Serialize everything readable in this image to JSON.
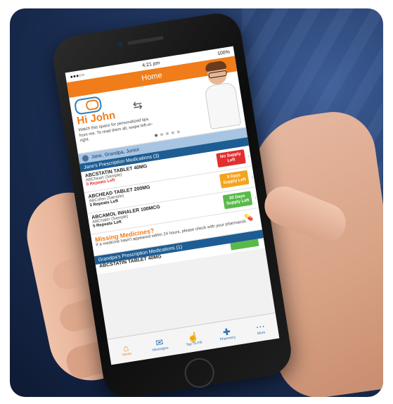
{
  "status": {
    "time": "4:21 pm",
    "battery": "100%",
    "carrier": "●●●○○"
  },
  "nav": {
    "title": "Home"
  },
  "hero": {
    "greeting": "Hi John",
    "tip": "Watch this space for personalized tips from me. To read them all, swipe left-or-right.",
    "swipe_icon": "swipe-hand-icon",
    "dots": [
      true,
      false,
      false,
      false,
      false
    ]
  },
  "patients": {
    "label": "Jane, Grandpa, Junior"
  },
  "sections": [
    {
      "title": "Jane's Prescription Medications (3)",
      "meds": [
        {
          "name": "ABCSTATIN TABLET 40MG",
          "brand": "ABCheart (Sample)",
          "repeats": "0 Repeats Left",
          "alert": true,
          "badge": "No Supply Left",
          "badge_color": "#e12f2f"
        },
        {
          "name": "ABCHEAD TABLET 200MG",
          "brand": "ABCofen (Sample)",
          "repeats": "3 Repeats Left",
          "alert": false,
          "badge": "5 Days Supply Left",
          "badge_color": "#f4a31b"
        },
        {
          "name": "ABCAMOL INHALER 100MCG",
          "brand": "ABChaler (Sample)",
          "repeats": "5 Repeats Left",
          "alert": false,
          "badge": "30 Days Supply Left",
          "badge_color": "#5ab94b"
        }
      ]
    }
  ],
  "missing": {
    "title": "Missing Medicines?",
    "text": "If a medicine hasn't appeared within 24 hours, please check with your pharmacist."
  },
  "grandpa": {
    "title": "Grandpa's Prescription Medications (1)",
    "first_med": "ABCSTATIN TABLET 40MG"
  },
  "tabs": [
    {
      "label": "Home",
      "icon": "home-icon",
      "active": true
    },
    {
      "label": "Messages",
      "icon": "messages-icon",
      "active": false
    },
    {
      "label": "Tap-To-Fill",
      "icon": "tap-to-fill-icon",
      "active": false
    },
    {
      "label": "Pharmacy",
      "icon": "pharmacy-icon",
      "active": false
    },
    {
      "label": "More",
      "icon": "more-icon",
      "active": false
    }
  ],
  "colors": {
    "accent": "#f07c1a",
    "header_blue": "#1e5d93",
    "patient_bar": "#a7c4e2"
  }
}
